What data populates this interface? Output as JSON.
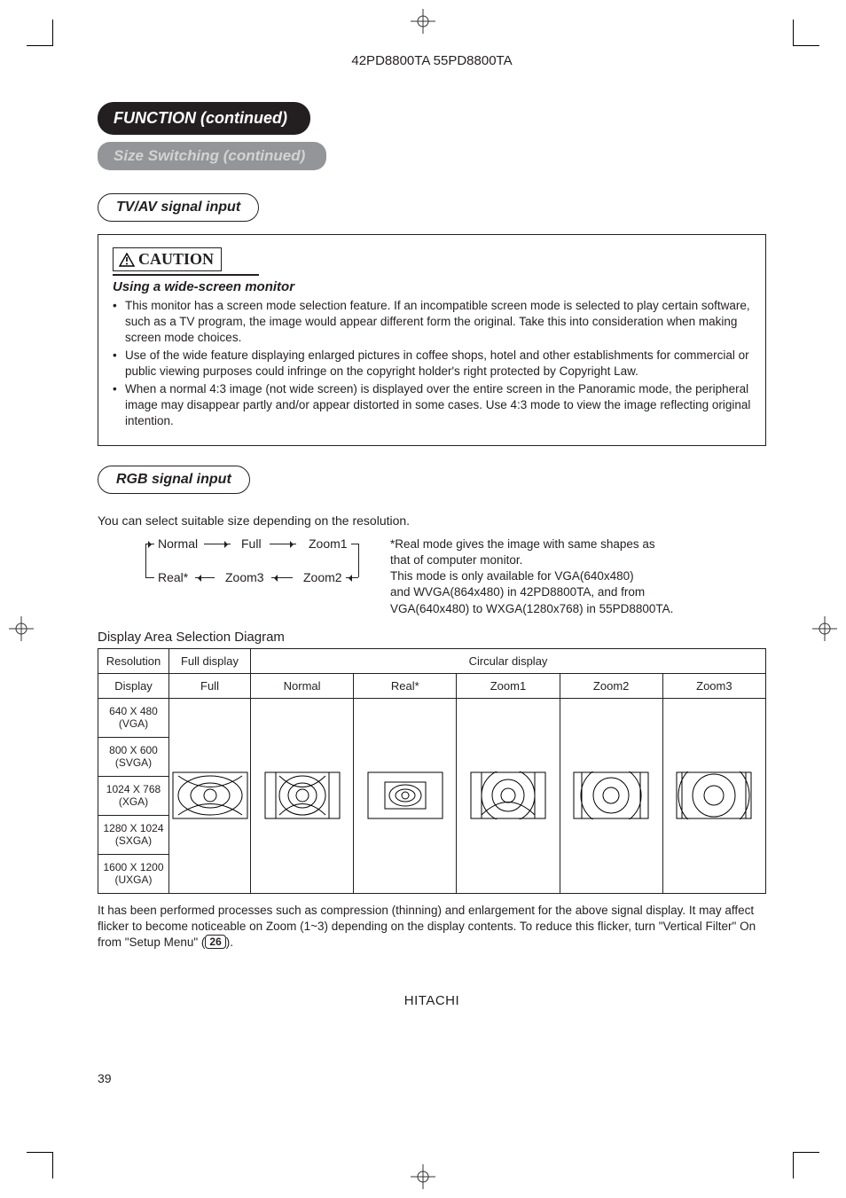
{
  "header": {
    "models": "42PD8800TA  55PD8800TA"
  },
  "titles": {
    "function": "FUNCTION (continued)",
    "size_switch": "Size Switching (continued)",
    "tvav": "TV/AV signal input",
    "rgb": "RGB signal input"
  },
  "caution": {
    "word": "CAUTION",
    "heading": "Using a wide-screen monitor",
    "bullets": [
      "This monitor has a screen mode selection feature. If an incompatible screen mode is selected to play certain software, such as a TV program, the image would appear different form the original. Take this into consideration when making screen mode choices.",
      "Use of the wide feature displaying enlarged pictures in coffee shops, hotel and other establishments for commercial or public viewing purposes could infringe on the copyright holder's right protected by Copyright Law.",
      "When a normal 4:3 image (not wide screen) is displayed over the entire screen in the Panoramic mode, the peripheral image may disappear partly and/or appear distorted in some cases. Use 4:3 mode to view the image reflecting original intention."
    ]
  },
  "rgb": {
    "intro": "You can select suitable size depending on the resolution.",
    "modes": {
      "normal": "Normal",
      "full": "Full",
      "zoom1": "Zoom1",
      "real": "Real*",
      "zoom3": "Zoom3",
      "zoom2": "Zoom2"
    },
    "note_lines": [
      "*Real mode gives the image with same shapes as",
      " that of computer monitor.",
      " This mode is only available for VGA(640x480)",
      " and WVGA(864x480) in 42PD8800TA, and from",
      " VGA(640x480) to WXGA(1280x768) in 55PD8800TA."
    ]
  },
  "diagram": {
    "title": "Display Area Selection Diagram",
    "headers": {
      "resolution": "Resolution",
      "full_display": "Full display",
      "circular_display": "Circular display",
      "display": "Display",
      "full": "Full",
      "normal": "Normal",
      "real": "Real*",
      "zoom1": "Zoom1",
      "zoom2": "Zoom2",
      "zoom3": "Zoom3"
    },
    "rows": [
      "640 X 480 (VGA)",
      "800 X 600 (SVGA)",
      "1024 X 768 (XGA)",
      "1280 X 1024 (SXGA)",
      "1600 X 1200 (UXGA)"
    ]
  },
  "footnote": {
    "t1": "It has been performed processes such as compression (thinning) and enlargement for the above signal display. It may affect flicker to become noticeable on Zoom (1~3) depending on the display contents. To reduce this flicker, turn \"Vertical Filter\" On from \"Setup Menu\" (",
    "ref": "26",
    "t2": ")."
  },
  "page_number": "39",
  "brand": "HITACHI"
}
